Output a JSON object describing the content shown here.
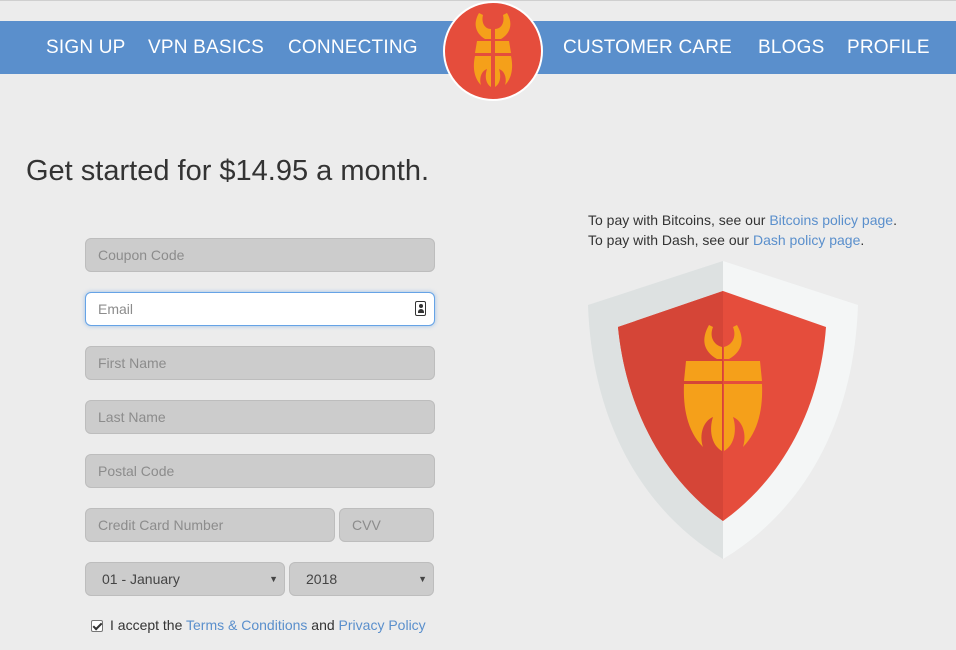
{
  "nav": {
    "items": [
      "SIGN UP",
      "VPN BASICS",
      "CONNECTING",
      "CUSTOMER CARE",
      "BLOGS",
      "PROFILE"
    ]
  },
  "colors": {
    "nav_background": "#5a8fcc",
    "logo_red": "#e54d3c",
    "logo_orange": "#f5a01a",
    "link": "#5a8fcc",
    "page_background": "#ececec"
  },
  "heading": "Get started for $14.95 a month.",
  "form": {
    "coupon_placeholder": "Coupon Code",
    "email_placeholder": "Email",
    "first_name_placeholder": "First Name",
    "last_name_placeholder": "Last Name",
    "postal_placeholder": "Postal Code",
    "card_placeholder": "Credit Card Number",
    "cvv_placeholder": "CVV",
    "month_value": "01 - January",
    "year_value": "2018",
    "caret_glyph": "▼",
    "accept_prefix": "I accept the ",
    "terms_link": "Terms & Conditions",
    "accept_and": " and ",
    "privacy_link": "Privacy Policy",
    "accept_checked": true
  },
  "payment": {
    "bitcoin_prefix": "To pay with Bitcoins, see our ",
    "bitcoin_link": "Bitcoins policy page",
    "dash_prefix": "To pay with Dash, see our ",
    "dash_link": "Dash policy page",
    "suffix": "."
  },
  "icons": {
    "logo": "horned-helmet-logo-icon",
    "shield": "shield-logo-icon",
    "autofill": "contact-card-icon"
  }
}
